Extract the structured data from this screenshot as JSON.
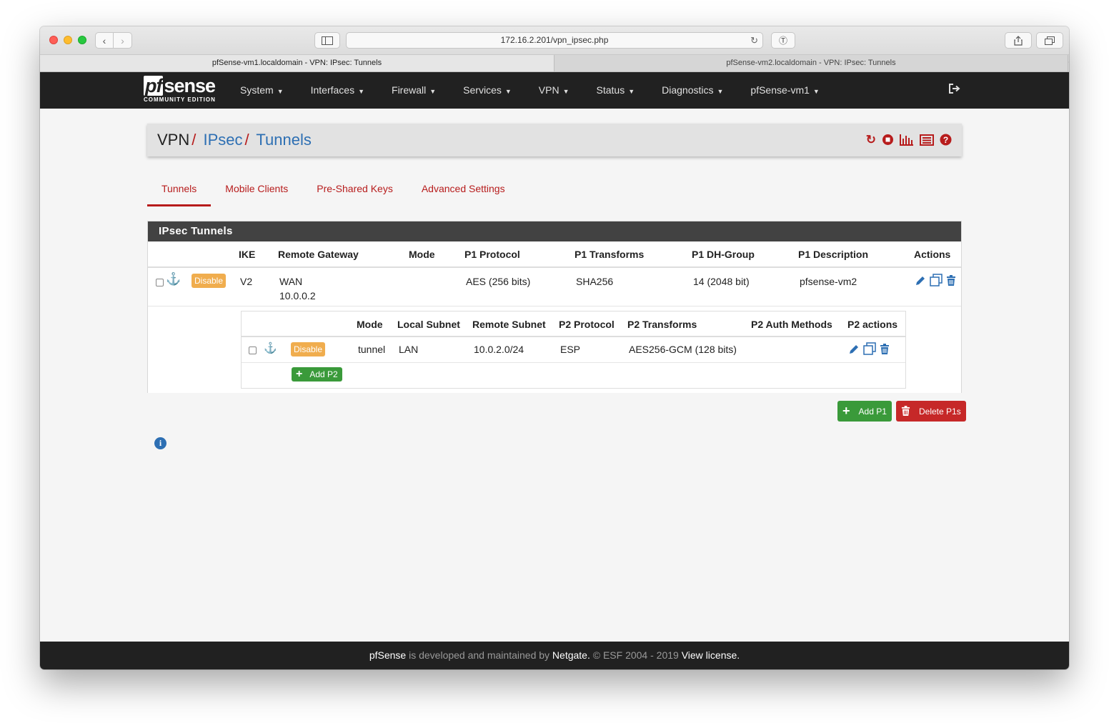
{
  "browser": {
    "url": "172.16.2.201/vpn_ipsec.php",
    "tabs": [
      {
        "title": "pfSense-vm1.localdomain - VPN: IPsec: Tunnels",
        "active": true
      },
      {
        "title": "pfSense-vm2.localdomain - VPN: IPsec: Tunnels",
        "active": false
      }
    ],
    "new_tab_label": "+"
  },
  "navbar": {
    "logo_pf": "pf",
    "logo_sense": "sense",
    "logo_edition": "COMMUNITY EDITION",
    "menu": [
      "System",
      "Interfaces",
      "Firewall",
      "Services",
      "VPN",
      "Status",
      "Diagnostics",
      "pfSense-vm1"
    ]
  },
  "breadcrumb": {
    "root": "VPN",
    "level2": "IPsec",
    "level3": "Tunnels",
    "sep": "/"
  },
  "subtabs": [
    "Tunnels",
    "Mobile Clients",
    "Pre-Shared Keys",
    "Advanced Settings"
  ],
  "panel": {
    "title": "IPsec Tunnels",
    "p1_headers": [
      "IKE",
      "Remote Gateway",
      "Mode",
      "P1 Protocol",
      "P1 Transforms",
      "P1 DH-Group",
      "P1 Description",
      "Actions"
    ],
    "p1_row": {
      "disable_label": "Disable",
      "ike": "V2",
      "remote_gateway_if": "WAN",
      "remote_gateway_ip": "10.0.0.2",
      "mode": "",
      "protocol": "AES (256 bits)",
      "transforms": "SHA256",
      "dh_group": "14 (2048 bit)",
      "description": "pfsense-vm2"
    },
    "p2_headers": [
      "Mode",
      "Local Subnet",
      "Remote Subnet",
      "P2 Protocol",
      "P2 Transforms",
      "P2 Auth Methods",
      "P2 actions"
    ],
    "p2_row": {
      "disable_label": "Disable",
      "mode": "tunnel",
      "local_subnet": "LAN",
      "remote_subnet": "10.0.2.0/24",
      "protocol": "ESP",
      "transforms": "AES256-GCM (128 bits)",
      "auth_methods": ""
    },
    "add_p2_label": "Add P2"
  },
  "buttons": {
    "add_p1": "Add P1",
    "delete_p1s": "Delete P1s"
  },
  "footer": {
    "brand": "pfSense",
    "text1": " is developed and maintained by ",
    "company": "Netgate.",
    "text2": " © ESF 2004 - 2019 ",
    "license": "View license."
  },
  "colors": {
    "accent_red": "#b71c1c",
    "link_blue": "#2d6fb3",
    "navbar_bg": "#212121",
    "warning_badge": "#f0ad4e",
    "success_btn": "#3a9a3a",
    "danger_btn": "#c62828"
  },
  "icons": {
    "crumb_actions": [
      "restart-icon",
      "stop-icon",
      "status-chart-icon",
      "log-icon",
      "help-icon"
    ],
    "row_actions": [
      "edit-icon",
      "copy-icon",
      "delete-icon"
    ]
  }
}
